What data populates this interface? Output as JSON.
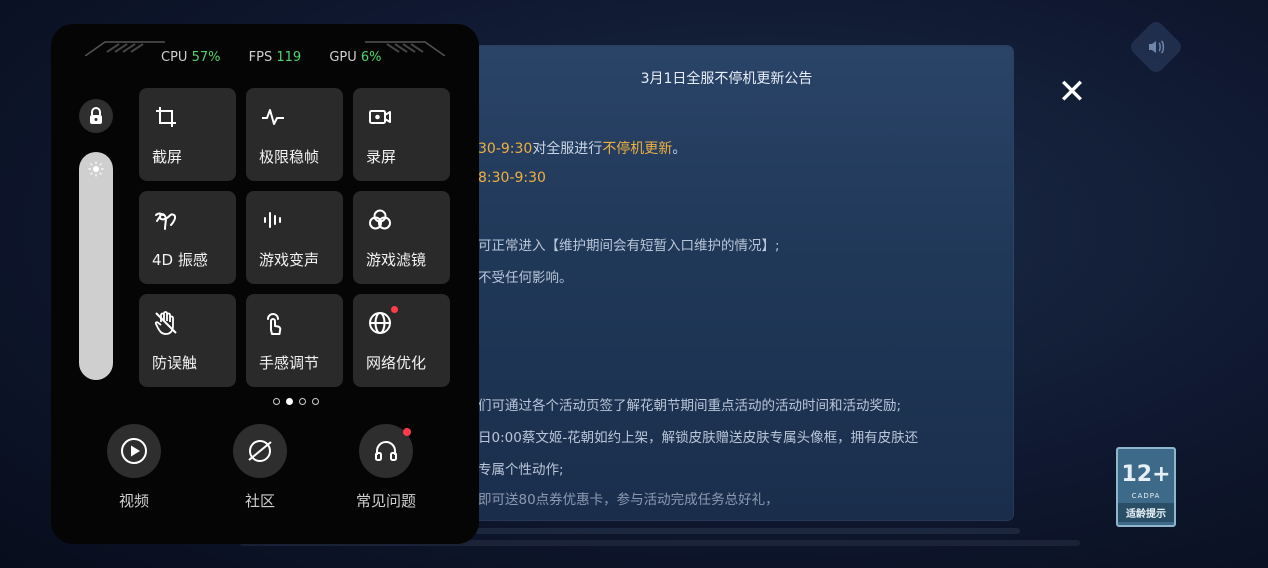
{
  "stats": {
    "cpu_label": "CPU",
    "cpu_value": "57%",
    "fps_label": "FPS",
    "fps_value": "119",
    "gpu_label": "GPU",
    "gpu_value": "6%"
  },
  "brightness_level": 1.0,
  "tiles": [
    {
      "label": "截屏",
      "icon": "crop-icon"
    },
    {
      "label": "极限稳帧",
      "icon": "pulse-icon"
    },
    {
      "label": "录屏",
      "icon": "video-record-icon"
    },
    {
      "label": "4D 振感",
      "icon": "vibration-icon"
    },
    {
      "label": "游戏变声",
      "icon": "voice-wave-icon"
    },
    {
      "label": "游戏滤镜",
      "icon": "filter-icon"
    },
    {
      "label": "防误触",
      "icon": "no-touch-hand-icon"
    },
    {
      "label": "手感调节",
      "icon": "touch-finger-icon"
    },
    {
      "label": "网络优化",
      "icon": "globe-icon"
    }
  ],
  "pager": {
    "count": 4,
    "active": 1
  },
  "bottom": [
    {
      "label": "视频",
      "icon": "play-icon"
    },
    {
      "label": "社区",
      "icon": "planet-icon"
    },
    {
      "label": "常见问题",
      "icon": "headset-icon"
    }
  ],
  "notice": {
    "title": "3月1日全服不停机更新公告",
    "line1_a": "30-9:30",
    "line1_b": "对全服进行",
    "line1_c": "不停机更新",
    "line1_d": "。",
    "line2": "8:30-9:30",
    "line3": "可正常进入【维护期间会有短暂入口维护的情况】;",
    "line4": "不受任何影响。",
    "line5": "们可通过各个活动页签了解花朝节期间重点活动的活动时间和活动奖励;",
    "line6": "日0:00蔡文姬-花朝如约上架，解锁皮肤赠送皮肤专属头像框，拥有皮肤还",
    "line7": "专属个性动作;",
    "line8": "即可送80点券优惠卡，参与活动完成任务总好礼，"
  },
  "age_badge": {
    "num": "12+",
    "org": "CADPA",
    "tip": "适龄提示"
  },
  "colors": {
    "accent_green": "#52d36c",
    "notice_orange": "#f0b040",
    "badge_red": "#ff3b4a"
  }
}
